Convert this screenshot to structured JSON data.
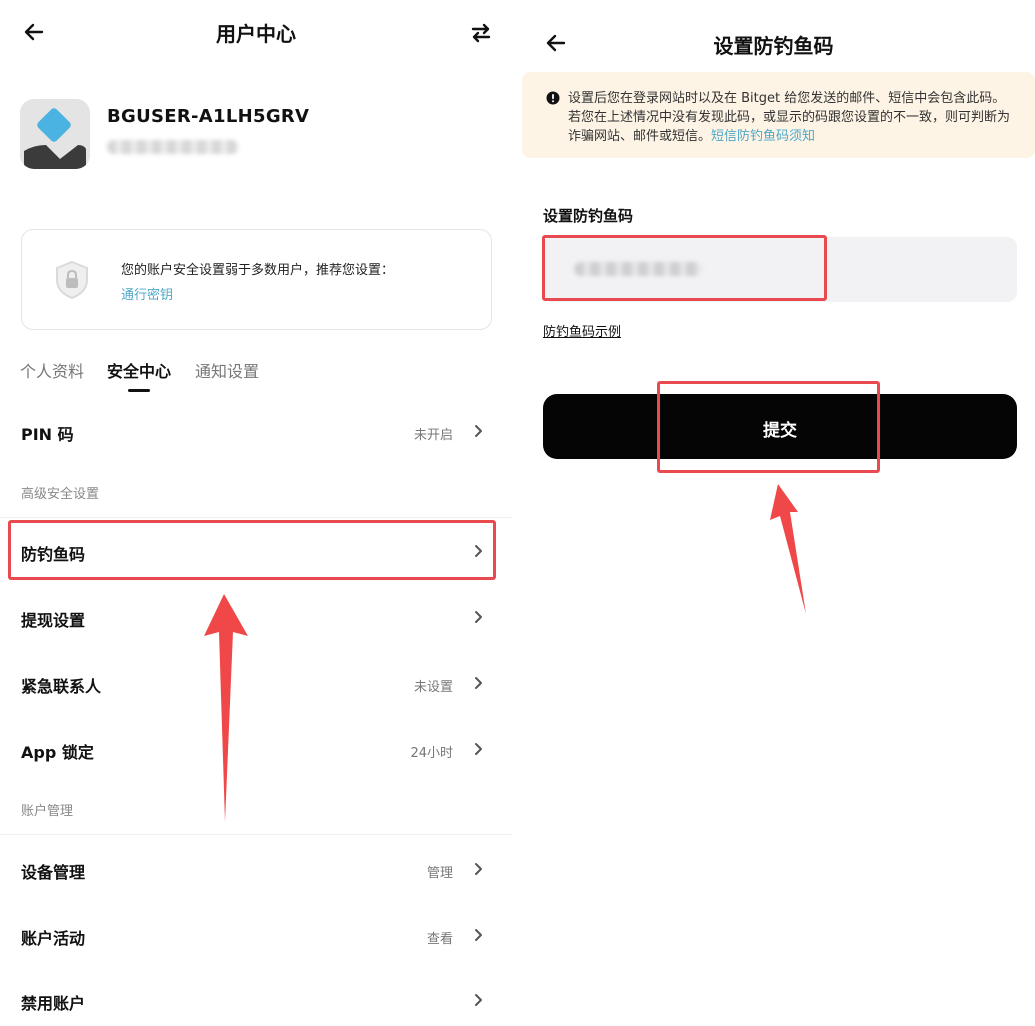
{
  "left": {
    "header": {
      "title": "用户中心"
    },
    "user": {
      "name": "BGUSER-A1LH5GRV"
    },
    "security_card": {
      "message": "您的账户安全设置弱于多数用户，推荐您设置：",
      "link": "通行密钥"
    },
    "tabs": [
      {
        "label": "个人资料",
        "active": false
      },
      {
        "label": "安全中心",
        "active": true
      },
      {
        "label": "通知设置",
        "active": false
      }
    ],
    "rows": [
      {
        "label": "PIN 码",
        "value": "未开启"
      },
      {
        "label": "防钓鱼码",
        "value": ""
      },
      {
        "label": "提现设置",
        "value": ""
      },
      {
        "label": "紧急联系人",
        "value": "未设置"
      },
      {
        "label": "App 锁定",
        "value": "24小时"
      },
      {
        "label": "设备管理",
        "value": "管理"
      },
      {
        "label": "账户活动",
        "value": "查看"
      },
      {
        "label": "禁用账户",
        "value": ""
      }
    ],
    "groups": {
      "advanced": "高级安全设置",
      "account": "账户管理"
    }
  },
  "right": {
    "header": {
      "title": "设置防钓鱼码"
    },
    "notice": {
      "text": "设置后您在登录网站时以及在 Bitget 给您发送的邮件、短信中会包含此码。若您在上述情况中没有发现此码，或显示的码跟您设置的不一致，则可判断为诈骗网站、邮件或短信。",
      "link": "短信防钓鱼码须知"
    },
    "field": {
      "label": "设置防钓鱼码"
    },
    "example_link": "防钓鱼码示例",
    "submit": {
      "label": "提交"
    }
  },
  "colors": {
    "highlight": "#e84a4f",
    "link": "#4fa7c8",
    "notice_bg": "#fdf4e5",
    "button_bg": "#050505",
    "field_bg": "#f2f2f4"
  }
}
